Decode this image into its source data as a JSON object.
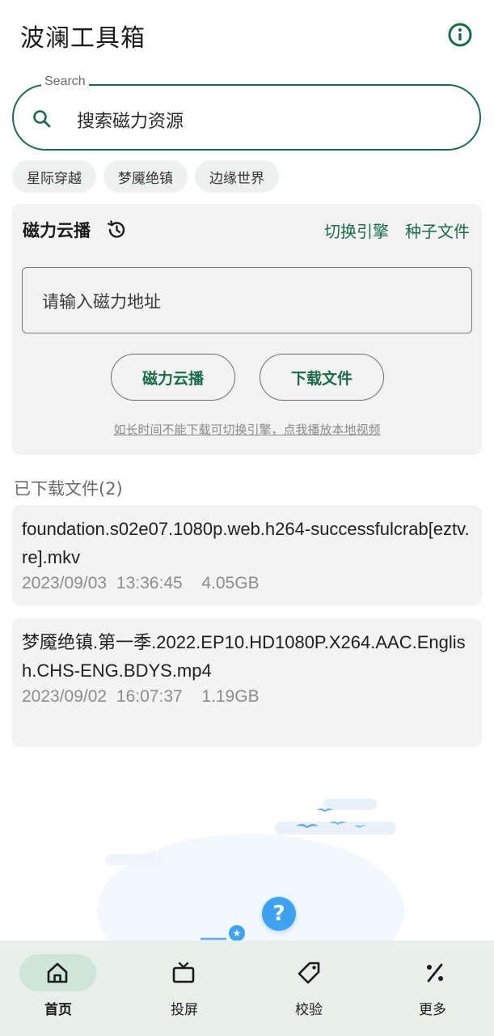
{
  "header": {
    "title": "波澜工具箱",
    "info_icon": "info-icon"
  },
  "search": {
    "label": "Search",
    "placeholder": "搜索磁力资源",
    "icon": "search-icon"
  },
  "chips": [
    "星际穿越",
    "梦魇绝镇",
    "边缘世界"
  ],
  "magnet_card": {
    "title": "磁力云播",
    "history_icon": "history-icon",
    "switch_engine": "切换引擎",
    "torrent_file": "种子文件",
    "input_placeholder": "请输入磁力地址",
    "cloud_play_button": "磁力云播",
    "download_button": "下载文件",
    "hint": "如长时间不能下载可切换引擎，点我播放本地视频"
  },
  "downloads": {
    "title": "已下载文件(2)",
    "files": [
      {
        "name": "foundation.s02e07.1080p.web.h264-successfulcrab[eztv.re].mkv",
        "date": "2023/09/03 13:36:45",
        "size": "4.05GB"
      },
      {
        "name": "梦魇绝镇.第一季.2022.EP10.HD1080P.X264.AAC.English.CHS-ENG.BDYS.mp4",
        "date": "2023/09/02 16:07:37",
        "size": "1.19GB"
      }
    ]
  },
  "help": {
    "label": "?"
  },
  "bottom_nav": [
    {
      "label": "首页",
      "icon": "home-icon",
      "active": true
    },
    {
      "label": "投屏",
      "icon": "tv-icon",
      "active": false
    },
    {
      "label": "校验",
      "icon": "tag-icon",
      "active": false
    },
    {
      "label": "更多",
      "icon": "percent-icon",
      "active": false
    }
  ],
  "colors": {
    "accent": "#1b6b4a",
    "nav_bg": "#e8efeb",
    "nav_active": "#cde6d8",
    "card_bg": "#f2f3f2",
    "help_blue": "#3da2f0"
  }
}
